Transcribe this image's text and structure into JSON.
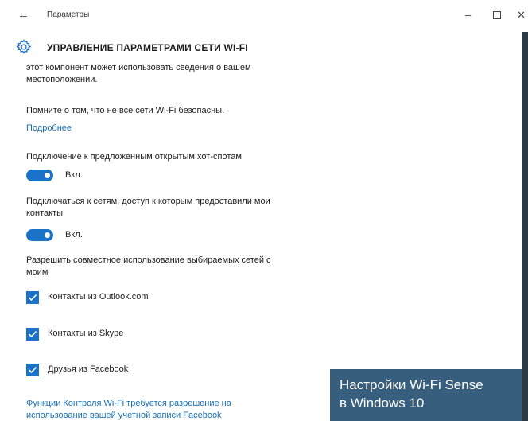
{
  "titlebar": {
    "back_glyph": "←",
    "title": "Параметры",
    "minimize_glyph": "–",
    "close_glyph": "✕"
  },
  "header": {
    "heading": "УПРАВЛЕНИЕ ПАРАМЕТРАМИ СЕТИ WI-FI",
    "icon": "gear-icon"
  },
  "content": {
    "location_text_line1": "этот компонент может использовать сведения о вашем",
    "location_text_line2": "местоположении.",
    "warning_text": "Помните о том, что не все сети Wi-Fi безопасны.",
    "more_link": "Подробнее",
    "hotspot_label": "Подключение к предложенным открытым хот-спотам",
    "hotspot_toggle": {
      "state_label": "Вкл.",
      "on": true
    },
    "contacts_label_line1": "Подключаться к сетям, доступ к которым предоставили мои",
    "contacts_label_line2": "контакты",
    "contacts_toggle": {
      "state_label": "Вкл.",
      "on": true
    },
    "share_label_line1": "Разрешить совместное использование выбираемых сетей с",
    "share_label_line2": "моим",
    "checkboxes": [
      {
        "label": "Контакты из Outlook.com",
        "checked": true
      },
      {
        "label": "Контакты из Skype",
        "checked": true
      },
      {
        "label": "Друзья из Facebook",
        "checked": true
      }
    ],
    "facebook_link_line1": "Функции Контроля Wi-Fi требуется разрешение на",
    "facebook_link_line2": "использование вашей учетной записи Facebook"
  },
  "caption": {
    "line1": "Настройки Wi-Fi Sense",
    "line2": "в Windows 10"
  },
  "colors": {
    "accent": "#1a73c9",
    "link": "#1a6fb4",
    "caption_bg": "#375e7c"
  }
}
